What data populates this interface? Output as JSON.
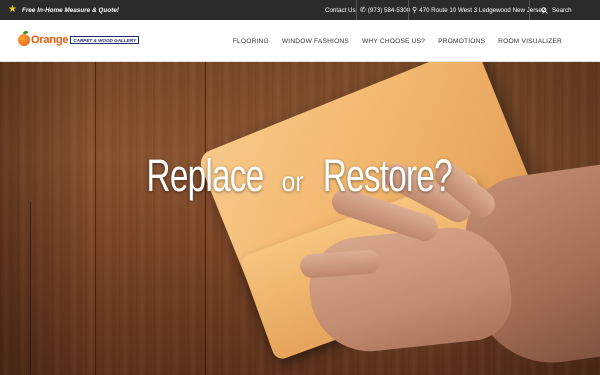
{
  "topbar": {
    "promo_icon": "star-icon",
    "promo_text": "Free In-Home Measure & Quote!",
    "contact_label": "Contact Us",
    "phone": "(973) 584-5300",
    "address": "470 Route 10 West 3 Ledgewood New Jersey",
    "search_label": "Search"
  },
  "header": {
    "logo_word": "Orange",
    "logo_tagline": "CARPET & WOOD GALLERY",
    "nav": [
      "FLOORING",
      "WINDOW FASHIONS",
      "WHY CHOOSE US?",
      "PROMOTIONS",
      "ROOM VISUALIZER"
    ]
  },
  "hero": {
    "title_part1": "Replace",
    "title_connector": "or",
    "title_part2": "Restore?"
  },
  "colors": {
    "topbar_bg": "#2b2b2b",
    "brand_orange": "#e8580c",
    "star": "#f5c518"
  }
}
